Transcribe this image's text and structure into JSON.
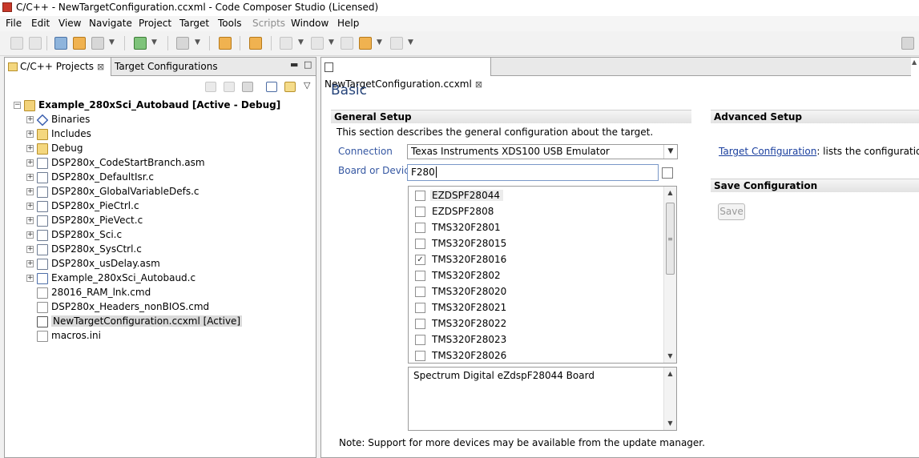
{
  "window": {
    "title": "C/C++ - NewTargetConfiguration.ccxml - Code Composer Studio (Licensed)"
  },
  "menu": [
    "File",
    "Edit",
    "View",
    "Navigate",
    "Project",
    "Target",
    "Tools",
    "Scripts",
    "Window",
    "Help"
  ],
  "left_panel": {
    "tabs": [
      {
        "label": "C/C++ Projects",
        "close": "⊠"
      },
      {
        "label": "Target Configurations"
      }
    ],
    "tree": {
      "project": "Example_280xSci_Autobaud  [Active - Debug]",
      "items": [
        {
          "label": "Binaries",
          "icon": "binaries-icon"
        },
        {
          "label": "Includes",
          "icon": "folder-icon"
        },
        {
          "label": "Debug",
          "icon": "folder-icon"
        },
        {
          "label": "DSP280x_CodeStartBranch.asm",
          "icon": "source-file-icon"
        },
        {
          "label": "DSP280x_DefaultIsr.c",
          "icon": "source-file-icon"
        },
        {
          "label": "DSP280x_GlobalVariableDefs.c",
          "icon": "source-file-icon"
        },
        {
          "label": "DSP280x_PieCtrl.c",
          "icon": "source-file-icon"
        },
        {
          "label": "DSP280x_PieVect.c",
          "icon": "source-file-icon"
        },
        {
          "label": "DSP280x_Sci.c",
          "icon": "source-file-icon"
        },
        {
          "label": "DSP280x_SysCtrl.c",
          "icon": "source-file-icon"
        },
        {
          "label": "DSP280x_usDelay.asm",
          "icon": "source-file-icon"
        },
        {
          "label": "Example_280xSci_Autobaud.c",
          "icon": "c-file-icon"
        },
        {
          "label": "28016_RAM_lnk.cmd",
          "icon": "cmd-file-icon"
        },
        {
          "label": "DSP280x_Headers_nonBIOS.cmd",
          "icon": "cmd-file-icon"
        },
        {
          "label": "NewTargetConfiguration.ccxml [Active]",
          "icon": "ccxml-file-icon"
        },
        {
          "label": "macros.ini",
          "icon": "ini-file-icon"
        }
      ]
    }
  },
  "editor": {
    "tab": {
      "label": "NewTargetConfiguration.ccxml",
      "close": "⊠"
    },
    "title": "Basic",
    "general_setup": {
      "header": "General Setup",
      "description": "This section describes the general configuration about the target.",
      "connection_label": "Connection",
      "connection_value": "Texas Instruments XDS100 USB Emulator",
      "board_label": "Board or Device",
      "board_filter": "F280",
      "devices": [
        {
          "name": "EZDSPF28044",
          "checked": false
        },
        {
          "name": "EZDSPF2808",
          "checked": false
        },
        {
          "name": "TMS320F2801",
          "checked": false
        },
        {
          "name": "TMS320F28015",
          "checked": false
        },
        {
          "name": "TMS320F28016",
          "checked": true
        },
        {
          "name": "TMS320F2802",
          "checked": false
        },
        {
          "name": "TMS320F28020",
          "checked": false
        },
        {
          "name": "TMS320F28021",
          "checked": false
        },
        {
          "name": "TMS320F28022",
          "checked": false
        },
        {
          "name": "TMS320F28023",
          "checked": false
        },
        {
          "name": "TMS320F28026",
          "checked": false
        }
      ],
      "device_description": "Spectrum Digital eZdspF28044 Board",
      "note": "Note: Support for more devices may be available from the update manager."
    },
    "advanced_setup": {
      "header": "Advanced Setup",
      "link": "Target Configuration",
      "link_suffix": ": lists the configuration op"
    },
    "save_configuration": {
      "header": "Save Configuration",
      "save_label": "Save"
    }
  }
}
